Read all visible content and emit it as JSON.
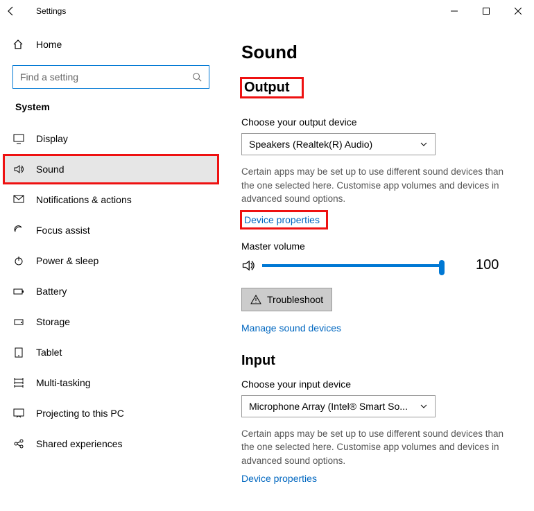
{
  "window": {
    "title": "Settings"
  },
  "sidebar": {
    "home": "Home",
    "search_placeholder": "Find a setting",
    "category": "System",
    "items": [
      {
        "label": "Display"
      },
      {
        "label": "Sound"
      },
      {
        "label": "Notifications & actions"
      },
      {
        "label": "Focus assist"
      },
      {
        "label": "Power & sleep"
      },
      {
        "label": "Battery"
      },
      {
        "label": "Storage"
      },
      {
        "label": "Tablet"
      },
      {
        "label": "Multi-tasking"
      },
      {
        "label": "Projecting to this PC"
      },
      {
        "label": "Shared experiences"
      }
    ]
  },
  "main": {
    "title": "Sound",
    "output": {
      "heading": "Output",
      "choose_label": "Choose your output device",
      "selected": "Speakers (Realtek(R) Audio)",
      "hint": "Certain apps may be set up to use different sound devices than the one selected here. Customise app volumes and devices in advanced sound options.",
      "device_props": "Device properties",
      "master_label": "Master volume",
      "volume": "100",
      "troubleshoot": "Troubleshoot",
      "manage": "Manage sound devices"
    },
    "input": {
      "heading": "Input",
      "choose_label": "Choose your input device",
      "selected": "Microphone Array (Intel® Smart So...",
      "hint": "Certain apps may be set up to use different sound devices than the one selected here. Customise app volumes and devices in advanced sound options.",
      "device_props": "Device properties"
    }
  }
}
